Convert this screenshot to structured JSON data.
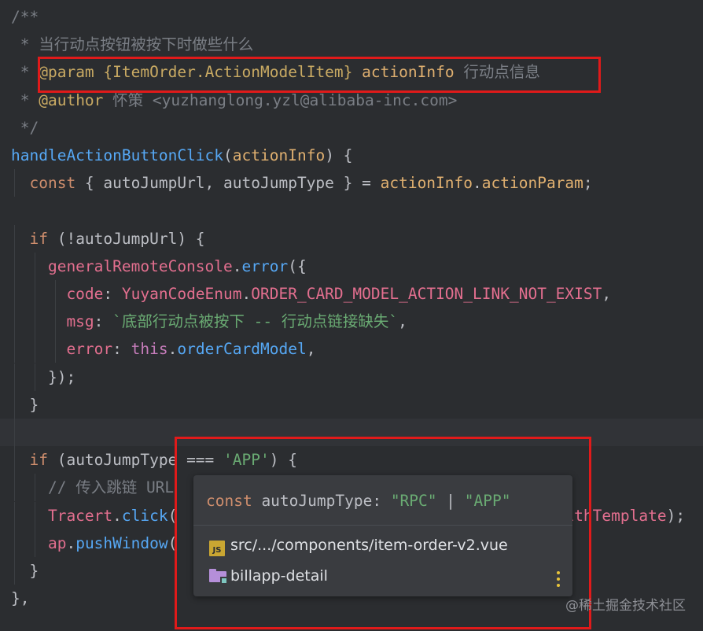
{
  "code_lines": [
    [
      {
        "t": "/**",
        "c": "c-cm"
      }
    ],
    [
      {
        "t": " * ",
        "c": "c-cm"
      },
      {
        "t": "当行动点按钮被按下时做些什么",
        "c": "c-cm cn"
      }
    ],
    [
      {
        "t": " * ",
        "c": "c-cm"
      },
      {
        "t": "@param",
        "c": "c-doc"
      },
      {
        "t": " {ItemOrder.ActionModelItem}",
        "c": "c-doc"
      },
      {
        "t": " actionInfo",
        "c": "c-par"
      },
      {
        "t": " ",
        "c": "c-cm"
      },
      {
        "t": "行动点信息",
        "c": "c-cm cn"
      }
    ],
    [
      {
        "t": " * ",
        "c": "c-cm"
      },
      {
        "t": "@author",
        "c": "c-doc"
      },
      {
        "t": " ",
        "c": "c-cm"
      },
      {
        "t": "怀策",
        "c": "c-cm cn"
      },
      {
        "t": " <yuzhanglong.yzl@alibaba-inc.com>",
        "c": "c-cm"
      }
    ],
    [
      {
        "t": " */",
        "c": "c-cm"
      }
    ],
    [
      {
        "t": "handleActionButtonClick",
        "c": "c-fn"
      },
      {
        "t": "(",
        "c": "c-id"
      },
      {
        "t": "actionInfo",
        "c": "c-par"
      },
      {
        "t": ") {",
        "c": "c-id"
      }
    ],
    [
      {
        "t": "  const",
        "c": "c-kw"
      },
      {
        "t": " { autoJumpUrl, autoJumpType } = ",
        "c": "c-id"
      },
      {
        "t": "actionInfo",
        "c": "c-par"
      },
      {
        "t": ".",
        "c": "c-id"
      },
      {
        "t": "actionParam",
        "c": "c-par"
      },
      {
        "t": ";",
        "c": "c-id"
      }
    ],
    [],
    [
      {
        "t": "  if",
        "c": "c-kw"
      },
      {
        "t": " (!autoJumpUrl) {",
        "c": "c-id"
      }
    ],
    [
      {
        "t": "    generalRemoteConsole",
        "c": "c-pink"
      },
      {
        "t": ".",
        "c": "c-id"
      },
      {
        "t": "error",
        "c": "c-fn"
      },
      {
        "t": "({",
        "c": "c-id"
      }
    ],
    [
      {
        "t": "      code",
        "c": "c-pink"
      },
      {
        "t": ": ",
        "c": "c-id"
      },
      {
        "t": "YuyanCodeEnum",
        "c": "c-pink"
      },
      {
        "t": ".",
        "c": "c-id"
      },
      {
        "t": "ORDER_CARD_MODEL_ACTION_LINK_NOT_EXIST",
        "c": "c-pink"
      },
      {
        "t": ",",
        "c": "c-id"
      }
    ],
    [
      {
        "t": "      msg",
        "c": "c-pink"
      },
      {
        "t": ": ",
        "c": "c-id"
      },
      {
        "t": "`",
        "c": "c-str"
      },
      {
        "t": "底部行动点被按下",
        "c": "c-str cn"
      },
      {
        "t": " -- ",
        "c": "c-str"
      },
      {
        "t": "行动点链接缺失",
        "c": "c-str cn"
      },
      {
        "t": "`",
        "c": "c-str"
      },
      {
        "t": ",",
        "c": "c-id"
      }
    ],
    [
      {
        "t": "      error",
        "c": "c-pink"
      },
      {
        "t": ": ",
        "c": "c-id"
      },
      {
        "t": "this",
        "c": "c-const"
      },
      {
        "t": ".",
        "c": "c-id"
      },
      {
        "t": "orderCardModel",
        "c": "c-fn"
      },
      {
        "t": ",",
        "c": "c-id"
      }
    ],
    [
      {
        "t": "    });",
        "c": "c-id"
      }
    ],
    [
      {
        "t": "  }",
        "c": "c-id"
      }
    ],
    [],
    [
      {
        "t": "  if",
        "c": "c-kw"
      },
      {
        "t": " (autoJumpType === ",
        "c": "c-id"
      },
      {
        "t": "'APP'",
        "c": "c-str"
      },
      {
        "t": ") {",
        "c": "c-id"
      }
    ],
    [
      {
        "t": "    // ",
        "c": "c-cm"
      },
      {
        "t": "传入跳链",
        "c": "c-cm cn"
      },
      {
        "t": " URL",
        "c": "c-cm"
      }
    ],
    [
      {
        "t": "    Tracert",
        "c": "c-pink"
      },
      {
        "t": ".",
        "c": "c-id"
      },
      {
        "t": "click",
        "c": "c-fn"
      },
      {
        "t": "(",
        "c": "c-id"
      },
      {
        "t": "                                          ",
        "c": "c-id"
      },
      {
        "t": "ithTemplate",
        "c": "c-pink"
      },
      {
        "t": ");",
        "c": "c-id"
      }
    ],
    [
      {
        "t": "    ap",
        "c": "c-pink"
      },
      {
        "t": ".",
        "c": "c-id"
      },
      {
        "t": "pushWindow",
        "c": "c-fn"
      },
      {
        "t": "(",
        "c": "c-id"
      }
    ],
    [
      {
        "t": "  }",
        "c": "c-id"
      }
    ],
    [
      {
        "t": "},",
        "c": "c-id"
      }
    ]
  ],
  "popup": {
    "sig_const": "const",
    "sig_name": " autoJumpType",
    "sig_colon": ": ",
    "sig_t1": "\"RPC\"",
    "sig_bar": " | ",
    "sig_t2": "\"APP\"",
    "file_icon_label": "JS",
    "file_path": "src/.../components/item-order-v2.vue",
    "module_name": "billapp-detail"
  },
  "icons": {
    "file": "js-file-icon",
    "folder": "module-folder-icon",
    "more": "kebab-menu-icon"
  },
  "watermark": "@稀土掘金技术社区",
  "colors": {
    "editor_bg": "#2b2d30",
    "highlight_line": "#313337",
    "annotation_red": "#e01a1a",
    "popup_bg": "#3a3c40"
  }
}
